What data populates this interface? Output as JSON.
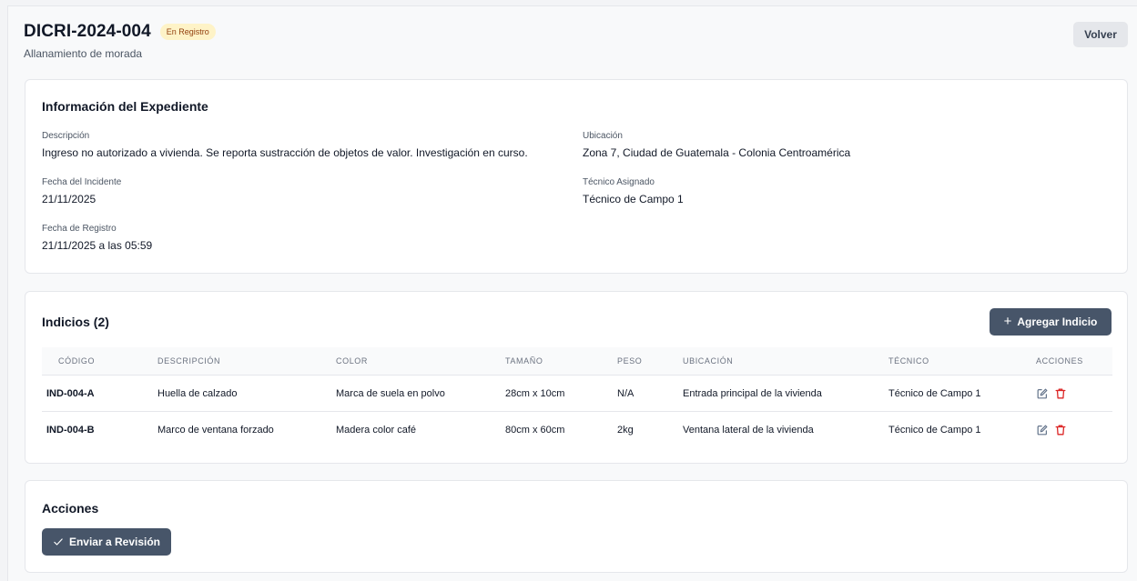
{
  "header": {
    "title": "DICRI-2024-004",
    "status_badge": "En Registro",
    "subtitle": "Allanamiento de morada",
    "back_label": "Volver"
  },
  "info": {
    "title": "Información del Expediente",
    "descripcion_label": "Descripción",
    "descripcion_value": "Ingreso no autorizado a vivienda. Se reporta sustracción de objetos de valor. Investigación en curso.",
    "ubicacion_label": "Ubicación",
    "ubicacion_value": "Zona 7, Ciudad de Guatemala - Colonia Centroamérica",
    "fecha_incidente_label": "Fecha del Incidente",
    "fecha_incidente_value": "21/11/2025",
    "tecnico_label": "Técnico Asignado",
    "tecnico_value": "Técnico de Campo 1",
    "fecha_registro_label": "Fecha de Registro",
    "fecha_registro_value": "21/11/2025 a las 05:59"
  },
  "indicios": {
    "title": "Indicios (2)",
    "add_label": "Agregar Indicio",
    "add_icon": "plus-icon",
    "columns": [
      "CÓDIGO",
      "DESCRIPCIÓN",
      "COLOR",
      "TAMAÑO",
      "PESO",
      "UBICACIÓN",
      "TÉCNICO",
      "ACCIONES"
    ],
    "rows": [
      [
        "IND-004-A",
        "Huella de calzado",
        "Marca de suela en polvo",
        "28cm x 10cm",
        "N/A",
        "Entrada principal de la vivienda",
        "Técnico de Campo 1"
      ],
      [
        "IND-004-B",
        "Marco de ventana forzado",
        "Madera color café",
        "80cm x 60cm",
        "2kg",
        "Ventana lateral de la vivienda",
        "Técnico de Campo 1"
      ]
    ],
    "row_icons": [
      "edit-icon",
      "trash-icon"
    ]
  },
  "acciones": {
    "title": "Acciones",
    "send_label": "Enviar a Revisión",
    "send_icon": "check-icon"
  },
  "colors": {
    "primary_button": "#475569",
    "badge_bg": "#fef3c7",
    "edit_icon": "#64748b",
    "delete_icon": "#dc2626"
  }
}
